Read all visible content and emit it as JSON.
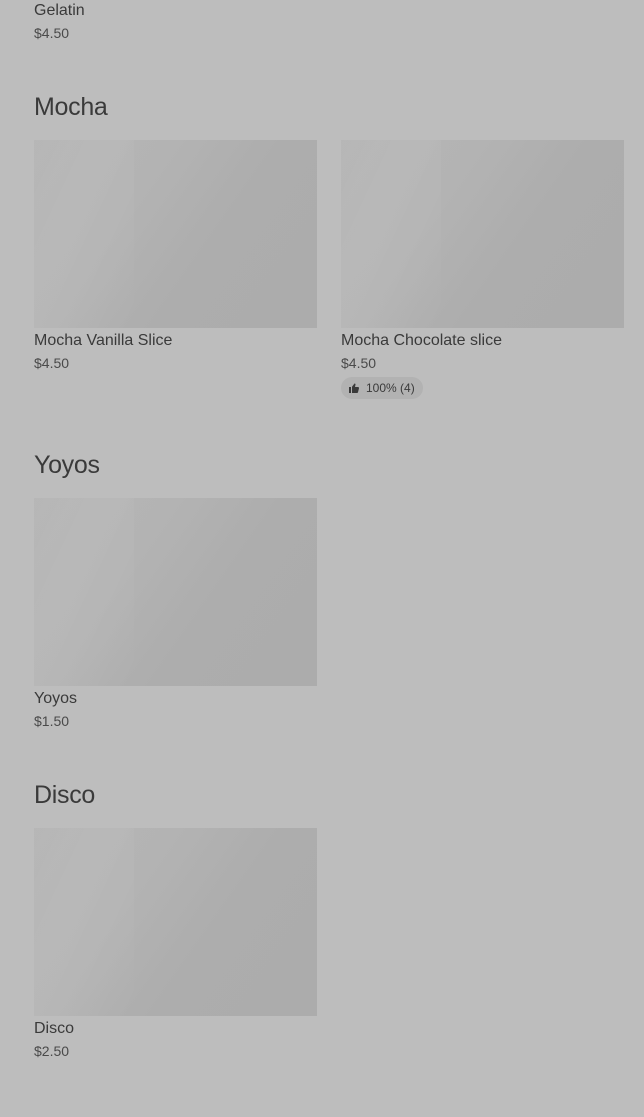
{
  "top_item": {
    "name": "Gelatin",
    "price": "$4.50"
  },
  "sections": [
    {
      "title": "Mocha",
      "items": [
        {
          "name": "Mocha Vanilla Slice",
          "price": "$4.50"
        },
        {
          "name": "Mocha Chocolate slice",
          "price": "$4.50",
          "rating": "100% (4)",
          "rating_icon": "thumbs-up-icon"
        }
      ]
    },
    {
      "title": "Yoyos",
      "items": [
        {
          "name": "Yoyos",
          "price": "$1.50"
        }
      ]
    },
    {
      "title": "Disco",
      "items": [
        {
          "name": "Disco",
          "price": "$2.50"
        }
      ]
    }
  ],
  "colors": {
    "overlay_background": "#bdbdbd",
    "placeholder": "#b0b0b0",
    "text": "#3a3a3a"
  }
}
